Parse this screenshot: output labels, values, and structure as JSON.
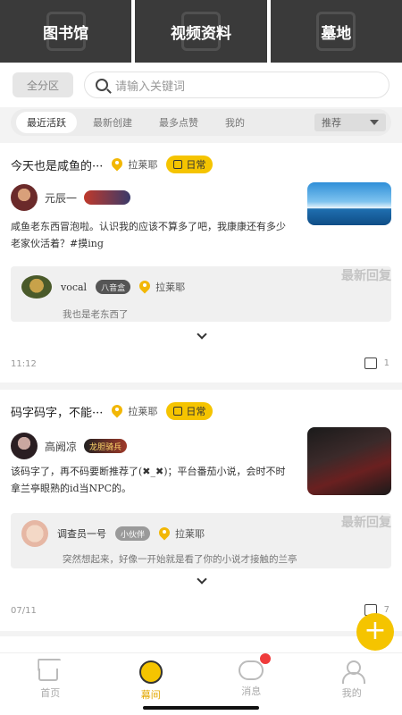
{
  "top_categories": [
    "图书馆",
    "视频资料",
    "墓地"
  ],
  "search": {
    "zone_label": "全分区",
    "placeholder": "请输入关键词"
  },
  "filters": {
    "tabs": [
      "最近活跃",
      "最新创建",
      "最多点赞",
      "我的"
    ],
    "active_index": 0,
    "sort_label": "推荐"
  },
  "posts": [
    {
      "title": "今天也是咸鱼的···",
      "location": "拉莱耶",
      "tag": "日常",
      "author": "元辰一",
      "badge": "",
      "body": "咸鱼老东西冒泡啦。认识我的应该不算多了吧，我康康还有多少老家伙活着？#摸ing",
      "reply_label": "最新回复",
      "reply": {
        "user": "vocal",
        "badge": "八音盒",
        "location": "拉莱耶",
        "text": "我也是老东西了"
      },
      "time": "11:12",
      "likes": "1"
    },
    {
      "title": "码字码字，不能···",
      "location": "拉莱耶",
      "tag": "日常",
      "author": "高阙凉",
      "badge": "龙胆骑兵",
      "body": "该码字了，再不码要断推荐了(✖_✖)；平台番茄小说，会时不时拿兰亭眼熟的id当NPC的。",
      "reply_label": "最新回复",
      "reply": {
        "user": "调查员一号",
        "badge": "小伙伴",
        "location": "拉莱耶",
        "text": "突然想起来，好像一开始就是看了你的小说才接触的兰亭"
      },
      "time": "07/11",
      "likes": "7"
    }
  ],
  "tabbar": [
    "首页",
    "幕间",
    "消息",
    "我的"
  ],
  "active_tab": 1,
  "colors": {
    "accent": "#f5c400",
    "dark_tile": "#3a3a3a",
    "notification": "#ef3b3b"
  }
}
